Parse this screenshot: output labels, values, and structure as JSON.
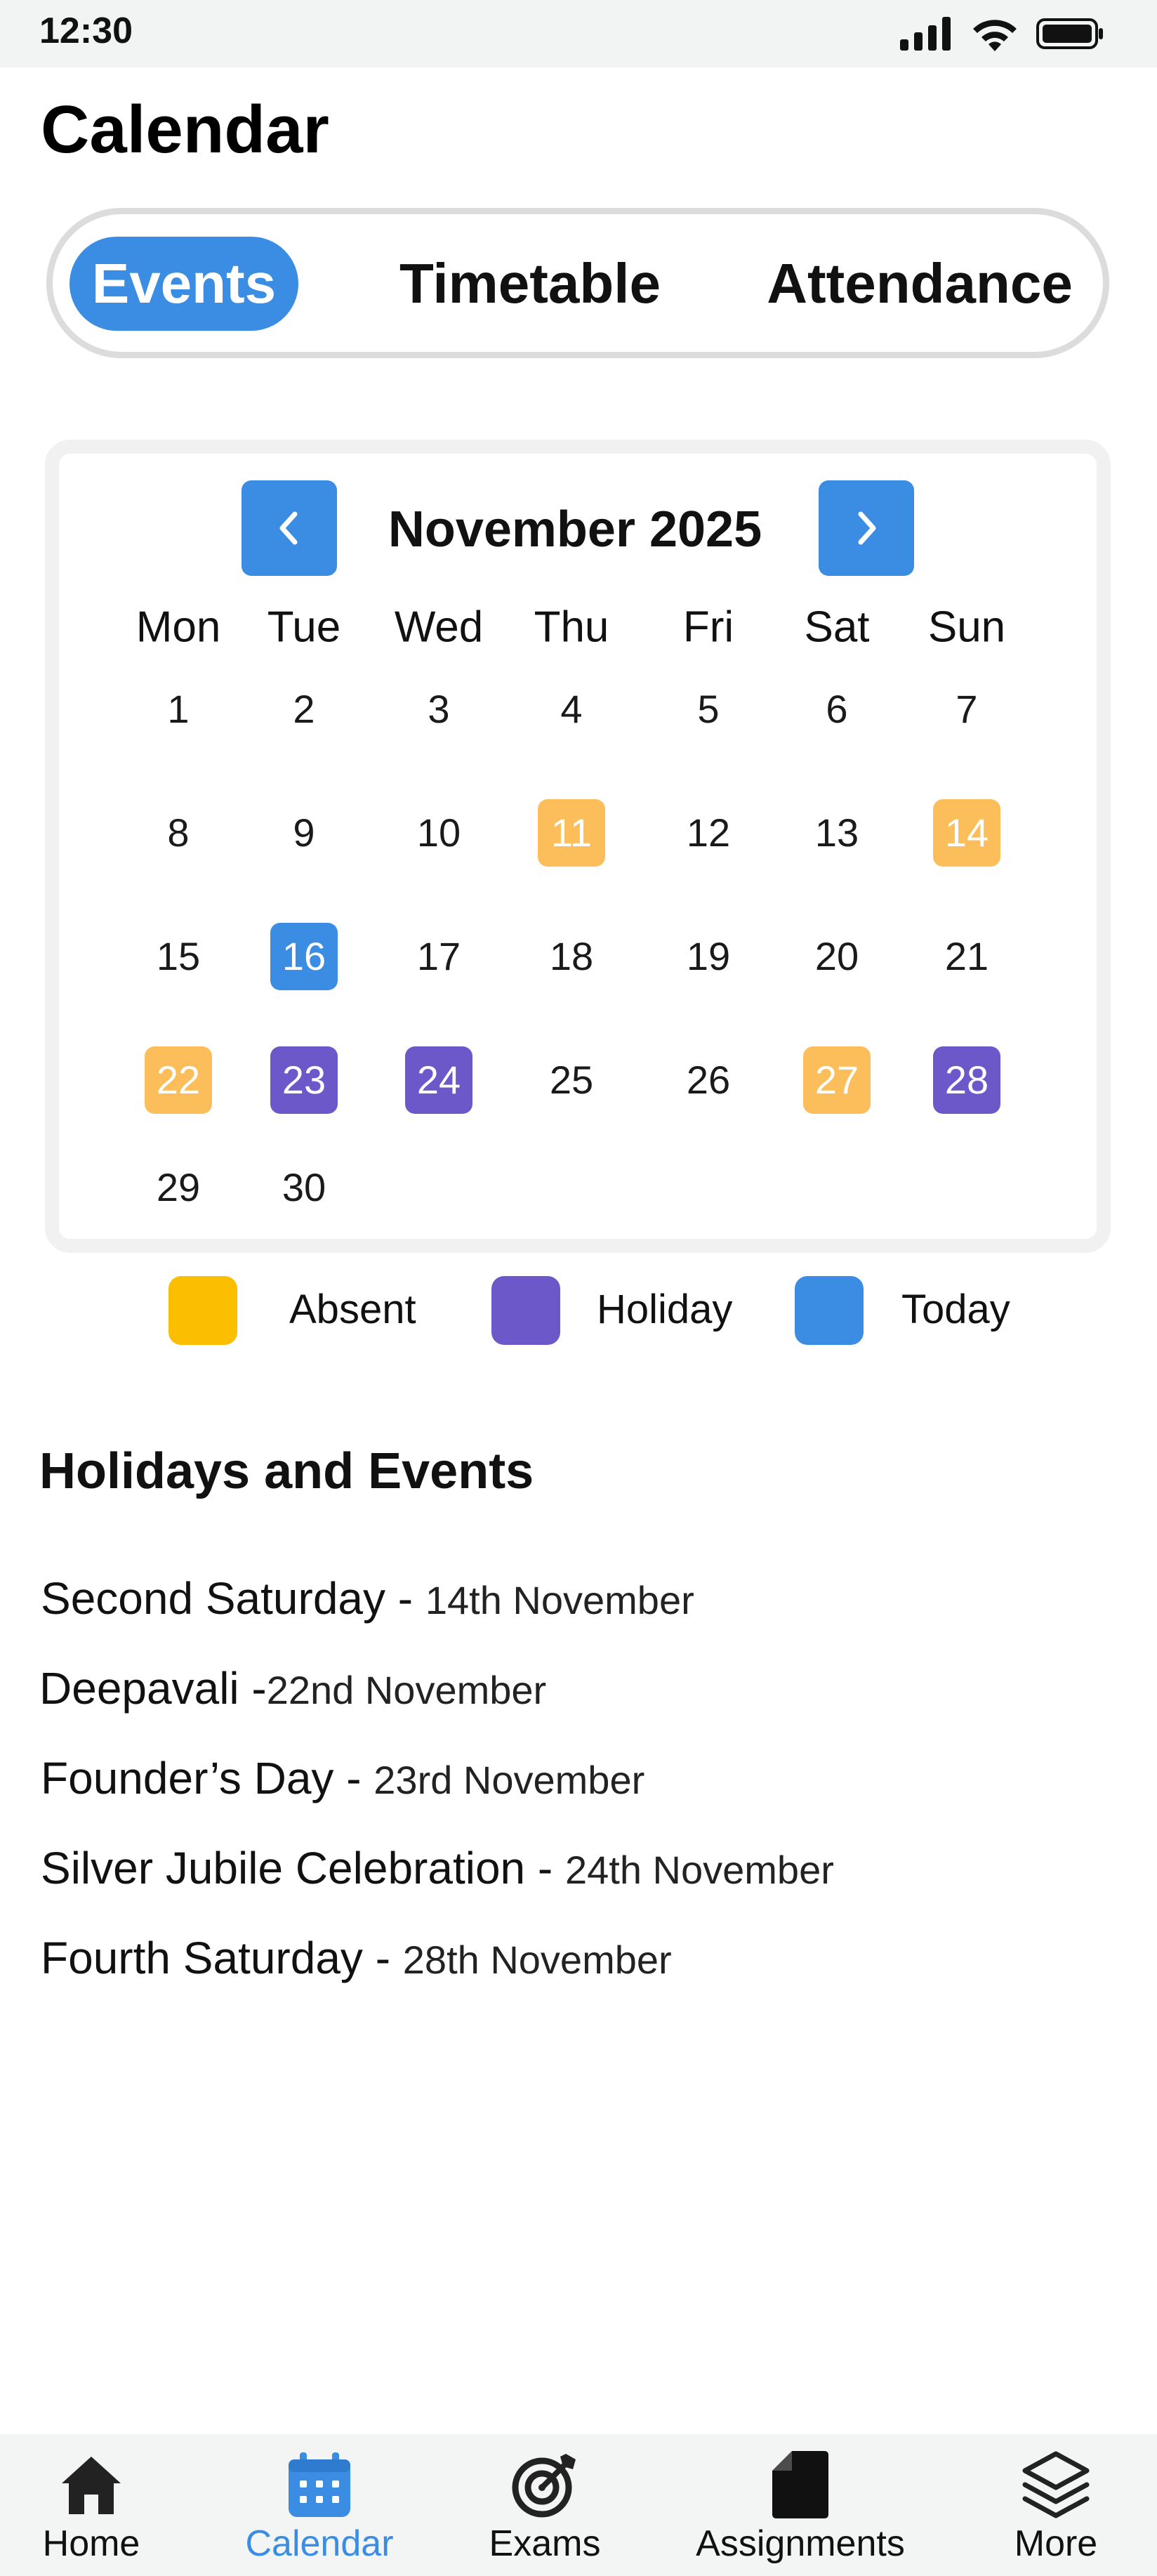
{
  "status": {
    "time": "12:30",
    "icons": [
      "signal-icon",
      "wifi-icon",
      "battery-icon"
    ]
  },
  "title": "Calendar",
  "tabs": [
    {
      "label": "Events",
      "active": true
    },
    {
      "label": "Timetable",
      "active": false
    },
    {
      "label": "Attendance",
      "active": false
    }
  ],
  "calendar": {
    "month": "November 2025",
    "weekdays": [
      "Mon",
      "Tue",
      "Wed",
      "Thu",
      "Fri",
      "Sat",
      "Sun"
    ],
    "days": [
      {
        "n": "1",
        "s": ""
      },
      {
        "n": "2",
        "s": ""
      },
      {
        "n": "3",
        "s": ""
      },
      {
        "n": "4",
        "s": ""
      },
      {
        "n": "5",
        "s": ""
      },
      {
        "n": "6",
        "s": ""
      },
      {
        "n": "7",
        "s": ""
      },
      {
        "n": "8",
        "s": ""
      },
      {
        "n": "9",
        "s": ""
      },
      {
        "n": "10",
        "s": ""
      },
      {
        "n": "11",
        "s": "absent"
      },
      {
        "n": "12",
        "s": ""
      },
      {
        "n": "13",
        "s": ""
      },
      {
        "n": "14",
        "s": "absent"
      },
      {
        "n": "15",
        "s": ""
      },
      {
        "n": "16",
        "s": "today"
      },
      {
        "n": "17",
        "s": ""
      },
      {
        "n": "18",
        "s": ""
      },
      {
        "n": "19",
        "s": ""
      },
      {
        "n": "20",
        "s": ""
      },
      {
        "n": "21",
        "s": ""
      },
      {
        "n": "22",
        "s": "absent"
      },
      {
        "n": "23",
        "s": "holiday"
      },
      {
        "n": "24",
        "s": "holiday"
      },
      {
        "n": "25",
        "s": ""
      },
      {
        "n": "26",
        "s": ""
      },
      {
        "n": "27",
        "s": "absent"
      },
      {
        "n": "28",
        "s": "holiday"
      },
      {
        "n": "29",
        "s": ""
      },
      {
        "n": "30",
        "s": ""
      }
    ]
  },
  "legend": [
    {
      "label": "Absent",
      "color": "#fbbe00"
    },
    {
      "label": "Holiday",
      "color": "#6c58c8"
    },
    {
      "label": "Today",
      "color": "#3a8de3"
    }
  ],
  "events_section": {
    "title": "Holidays and Events",
    "items": [
      {
        "name": "Second Saturday - ",
        "date": "14th November"
      },
      {
        "name": "Deepavali -",
        "date": "22nd November"
      },
      {
        "name": "Founder’s Day - ",
        "date": "23rd November"
      },
      {
        "name": "Silver Jubile Celebration - ",
        "date": "24th November"
      },
      {
        "name": "Fourth Saturday - ",
        "date": "28th November"
      }
    ]
  },
  "bottom_nav": [
    {
      "label": "Home",
      "icon": "home-icon",
      "active": false
    },
    {
      "label": "Calendar",
      "icon": "calendar-icon",
      "active": true
    },
    {
      "label": "Exams",
      "icon": "target-icon",
      "active": false
    },
    {
      "label": "Assignments",
      "icon": "document-icon",
      "active": false
    },
    {
      "label": "More",
      "icon": "layers-icon",
      "active": false
    }
  ],
  "colors": {
    "accent": "#3a8de3",
    "absent": "#fbbe5a",
    "holiday": "#6c58c8"
  }
}
